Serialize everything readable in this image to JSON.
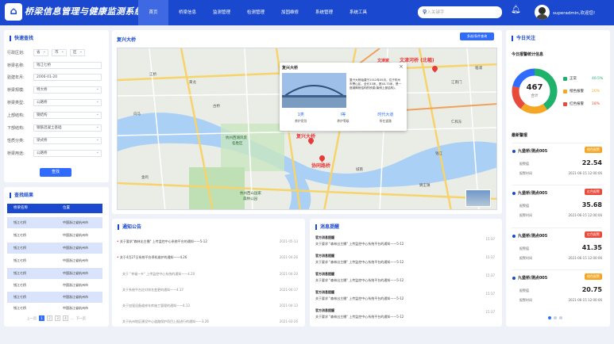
{
  "app": {
    "title": "桥梁信息管理与健康监测系统"
  },
  "nav": [
    "首页",
    "桥梁信息",
    "监测管理",
    "检测管理",
    "加固维修",
    "系统管理",
    "系统工具"
  ],
  "search": {
    "placeholder": "输入关键字"
  },
  "user": {
    "name": "superadmin,欢迎您!"
  },
  "quick": {
    "title": "快速查找",
    "region_label": "行政区划:",
    "province": "省",
    "city": "市",
    "district": "区",
    "fields": [
      {
        "label": "桥梁名称:",
        "value": "钱江七桥"
      },
      {
        "label": "验建年月:",
        "value": "2006-01-20"
      },
      {
        "label": "桥梁规模:",
        "value": "特大桥"
      },
      {
        "label": "桥梁类型:",
        "value": "公路桥"
      },
      {
        "label": "上部结构:",
        "value": "钢结构"
      },
      {
        "label": "下部结构:",
        "value": "钢筋混凝土基础"
      },
      {
        "label": "性质分类:",
        "value": "梁式桥"
      },
      {
        "label": "桥梁用途:",
        "value": "公路桥"
      }
    ],
    "search_btn": "查找"
  },
  "results": {
    "title": "查找结果",
    "col1": "桥梁名称",
    "col2": "位置",
    "rows": [
      [
        "钱江七桥",
        "中国浙江省杭州市"
      ],
      [
        "钱江七桥",
        "中国浙江省杭州市"
      ],
      [
        "钱江七桥",
        "中国浙江省杭州市"
      ],
      [
        "钱江七桥",
        "中国浙江省杭州市"
      ],
      [
        "钱江七桥",
        "中国浙江省杭州市"
      ],
      [
        "钱江七桥",
        "中国浙江省杭州市"
      ],
      [
        "钱江七桥",
        "中国浙江省杭州市"
      ],
      [
        "钱江七桥",
        "中国浙江省杭州市"
      ]
    ],
    "pager": {
      "prev": "上一页",
      "p1": "1",
      "p2": "2",
      "p3": "3",
      "p4": "4",
      "dots": "...",
      "next": "下一页"
    }
  },
  "map": {
    "title": "复兴大桥",
    "btn": "多选/条件查询",
    "labels": {
      "wenjin": "文津家",
      "wenjin2": "文津河桥 (北幅)",
      "jiangmen": "江南门",
      "jiangqiao": "江桥",
      "linpu": "临浦",
      "fuxing": "复兴大桥",
      "xietong": "协同路桥",
      "gubridge": "古桥",
      "sjt": "杭州市三堡",
      "xihu": "杭州西湖风景",
      "xihu2": "名胜区",
      "forest": "杭州西山国家",
      "forest2": "森林公园",
      "chengnan": "城南",
      "gupu": "钱江",
      "baiqiao": "白马",
      "huangnong": "黄龙",
      "jinji": "金鸡",
      "shiwei": "狮王镇",
      "renhe": "仁和东"
    },
    "popup": {
      "title": "复兴大桥",
      "desc": "复兴大桥始建于2012年05月，位于杭州市萧山区，全长33米，宽40.75米，是一座钢筒桥结构的桥梁(南侧上部结构)。",
      "stats": [
        {
          "v": "1类",
          "l": "养护类别"
        },
        {
          "v": "I等",
          "l": "养护等级"
        },
        {
          "v": "时代大道",
          "l": "所在道路"
        }
      ]
    }
  },
  "notice": {
    "title": "通知公告",
    "items": [
      {
        "t": "关于要求\"森林出主播\" 上传监控中心系统平台的通知——5-12",
        "d": "2021-05-13",
        "red": true
      },
      {
        "t": "关于4月27日系统平台停机维护的通知——4.26",
        "d": "2021-04-26",
        "red": true
      },
      {
        "t": "关于 \"幸福一乡\" 上传监控中心系统的通知——4.20",
        "d": "2021-04-20",
        "red": false
      },
      {
        "t": "关于系统平台应对排名变更的通知——4.17",
        "d": "2021-04-17",
        "red": false
      },
      {
        "t": "关于加强设备维修车库施工管理的通知——4.13",
        "d": "2021-04-13",
        "red": false
      },
      {
        "t": "关于杭州地区建设中心道路保护项目上报进行的通知——3.26",
        "d": "2021-03-26",
        "red": false
      }
    ]
  },
  "messages": {
    "title": "消息提醒",
    "items": [
      {
        "h": "官方消息提醒",
        "t": "关于要求 \"森林出主播\" 上传监控中心系统平台的通知——5-12",
        "time": "15:37"
      },
      {
        "h": "官方消息提醒",
        "t": "关于要求 \"森林出主播\" 上传监控中心系统平台的通知——5-12",
        "time": "15:37"
      },
      {
        "h": "官方消息提醒",
        "t": "关于要求 \"森林出主播\" 上传监控中心系统平台的通知——5-12",
        "time": "15:37"
      },
      {
        "h": "官方消息提醒",
        "t": "关于要求 \"森林出主播\" 上传监控中心系统平台的通知——5-12",
        "time": "15:37"
      },
      {
        "h": "官方消息提醒",
        "t": "关于要求 \"森林出主播\" 上传监控中心系统平台的通知——5-12",
        "time": "15:37"
      }
    ]
  },
  "today": {
    "title": "今日关注",
    "subtitle": "今日报警统计信息",
    "total": "467",
    "total_label": "合计",
    "legend": [
      {
        "name": "正常",
        "pct": "40.5%",
        "color": "#1eb26a"
      },
      {
        "name": "橙色报警",
        "pct": "20%",
        "color": "#f5a623"
      },
      {
        "name": "红色报警",
        "pct": "18%",
        "color": "#e84b3c"
      }
    ],
    "donut": [
      40.5,
      20,
      18,
      21.5
    ],
    "latest_title": "最新警报",
    "alarms": [
      {
        "name": "九堡桥/测点005",
        "badge": "橙色报警",
        "color": "#f5a623",
        "kv": "报警值",
        "v": "22.54",
        "kt": "报警时间",
        "t": "2021-06-15  12:00:06"
      },
      {
        "name": "九堡桥/测点005",
        "badge": "红色报警",
        "color": "#e84b3c",
        "kv": "报警值",
        "v": "35.68",
        "kt": "报警时间",
        "t": "2021-06-15  12:00:06"
      },
      {
        "name": "九堡桥/测点005",
        "badge": "红色报警",
        "color": "#e84b3c",
        "kv": "报警值",
        "v": "41.35",
        "kt": "报警时间",
        "t": "2021-06-15  12:00:06"
      },
      {
        "name": "九堡桥/测点005",
        "badge": "橙色报警",
        "color": "#f5a623",
        "kv": "报警值",
        "v": "20.75",
        "kt": "报警时间",
        "t": "2021-06-15  12:00:06"
      }
    ]
  }
}
